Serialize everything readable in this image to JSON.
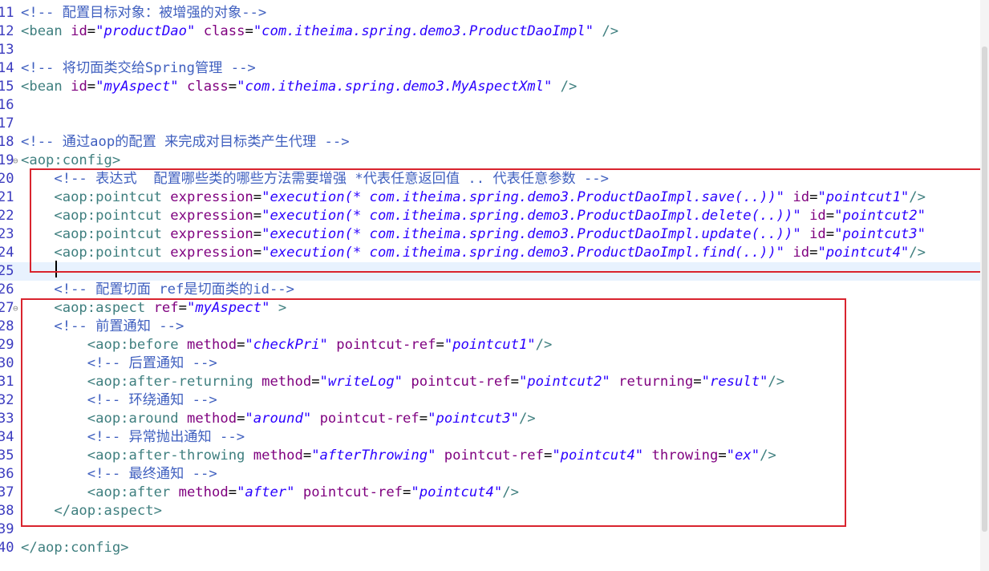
{
  "editor": {
    "lines": [
      {
        "n": "11",
        "segs": [
          {
            "t": "<!-- ",
            "c": "comment"
          },
          {
            "t": "配置目标对象：被增强的对象",
            "c": "comment"
          },
          {
            "t": "-->",
            "c": "comment"
          }
        ]
      },
      {
        "n": "12",
        "segs": [
          {
            "t": "<bean ",
            "c": "tag"
          },
          {
            "t": "id",
            "c": "attr"
          },
          {
            "t": "=",
            "c": "plain"
          },
          {
            "t": "\"productDao\"",
            "c": "val"
          },
          {
            "t": " ",
            "c": "plain"
          },
          {
            "t": "class",
            "c": "attr"
          },
          {
            "t": "=",
            "c": "plain"
          },
          {
            "t": "\"com.itheima.spring.demo3.ProductDaoImpl\"",
            "c": "val"
          },
          {
            "t": " />",
            "c": "tag"
          }
        ]
      },
      {
        "n": "13",
        "segs": []
      },
      {
        "n": "14",
        "segs": [
          {
            "t": "<!-- ",
            "c": "comment"
          },
          {
            "t": "将切面类交给",
            "c": "comment"
          },
          {
            "t": "Spring",
            "c": "comment"
          },
          {
            "t": "管理",
            "c": "comment"
          },
          {
            "t": " -->",
            "c": "comment"
          }
        ]
      },
      {
        "n": "15",
        "segs": [
          {
            "t": "<bean ",
            "c": "tag"
          },
          {
            "t": "id",
            "c": "attr"
          },
          {
            "t": "=",
            "c": "plain"
          },
          {
            "t": "\"myAspect\"",
            "c": "val"
          },
          {
            "t": " ",
            "c": "plain"
          },
          {
            "t": "class",
            "c": "attr"
          },
          {
            "t": "=",
            "c": "plain"
          },
          {
            "t": "\"com.itheima.spring.demo3.MyAspectXml\"",
            "c": "val"
          },
          {
            "t": " />",
            "c": "tag"
          }
        ]
      },
      {
        "n": "16",
        "segs": []
      },
      {
        "n": "17",
        "segs": []
      },
      {
        "n": "18",
        "segs": [
          {
            "t": "<!-- ",
            "c": "comment"
          },
          {
            "t": "通过",
            "c": "comment"
          },
          {
            "t": "aop",
            "c": "comment"
          },
          {
            "t": "的配置 来完成对目标类产生代理",
            "c": "comment"
          },
          {
            "t": " -->",
            "c": "comment"
          }
        ]
      },
      {
        "n": "19",
        "fold": "⊖",
        "segs": [
          {
            "t": "<aop:config>",
            "c": "tag"
          }
        ]
      },
      {
        "n": "20",
        "segs": [
          {
            "t": "    <!-- ",
            "c": "comment"
          },
          {
            "t": "表达式  配置哪些类的哪些方法需要增强",
            "c": "comment"
          },
          {
            "t": " *",
            "c": "comment"
          },
          {
            "t": "代表任意返回值",
            "c": "comment"
          },
          {
            "t": " .. ",
            "c": "comment"
          },
          {
            "t": "代表任意参数",
            "c": "comment"
          },
          {
            "t": " -->",
            "c": "comment"
          }
        ]
      },
      {
        "n": "21",
        "segs": [
          {
            "t": "    <aop:pointcut ",
            "c": "tag"
          },
          {
            "t": "expression",
            "c": "attr"
          },
          {
            "t": "=",
            "c": "plain"
          },
          {
            "t": "\"execution(* com.itheima.spring.demo3.ProductDaoImpl.save(..))\"",
            "c": "val"
          },
          {
            "t": " ",
            "c": "plain"
          },
          {
            "t": "id",
            "c": "attr"
          },
          {
            "t": "=",
            "c": "plain"
          },
          {
            "t": "\"pointcut1\"",
            "c": "val"
          },
          {
            "t": "/>",
            "c": "tag"
          }
        ]
      },
      {
        "n": "22",
        "segs": [
          {
            "t": "    <aop:pointcut ",
            "c": "tag"
          },
          {
            "t": "expression",
            "c": "attr"
          },
          {
            "t": "=",
            "c": "plain"
          },
          {
            "t": "\"execution(* com.itheima.spring.demo3.ProductDaoImpl.delete(..))\"",
            "c": "val"
          },
          {
            "t": " ",
            "c": "plain"
          },
          {
            "t": "id",
            "c": "attr"
          },
          {
            "t": "=",
            "c": "plain"
          },
          {
            "t": "\"pointcut2\"",
            "c": "val"
          }
        ]
      },
      {
        "n": "23",
        "segs": [
          {
            "t": "    <aop:pointcut ",
            "c": "tag"
          },
          {
            "t": "expression",
            "c": "attr"
          },
          {
            "t": "=",
            "c": "plain"
          },
          {
            "t": "\"execution(* com.itheima.spring.demo3.ProductDaoImpl.update(..))\"",
            "c": "val"
          },
          {
            "t": " ",
            "c": "plain"
          },
          {
            "t": "id",
            "c": "attr"
          },
          {
            "t": "=",
            "c": "plain"
          },
          {
            "t": "\"pointcut3\"",
            "c": "val"
          }
        ]
      },
      {
        "n": "24",
        "segs": [
          {
            "t": "    <aop:pointcut ",
            "c": "tag"
          },
          {
            "t": "expression",
            "c": "attr"
          },
          {
            "t": "=",
            "c": "plain"
          },
          {
            "t": "\"execution(* com.itheima.spring.demo3.ProductDaoImpl.find(..))\"",
            "c": "val"
          },
          {
            "t": " ",
            "c": "plain"
          },
          {
            "t": "id",
            "c": "attr"
          },
          {
            "t": "=",
            "c": "plain"
          },
          {
            "t": "\"pointcut4\"",
            "c": "val"
          },
          {
            "t": "/>",
            "c": "tag"
          }
        ]
      },
      {
        "n": "25",
        "current": true,
        "segs": []
      },
      {
        "n": "26",
        "segs": [
          {
            "t": "    <!-- ",
            "c": "comment"
          },
          {
            "t": "配置切面 ",
            "c": "comment"
          },
          {
            "t": "ref",
            "c": "comment"
          },
          {
            "t": "是切面类的",
            "c": "comment"
          },
          {
            "t": "id",
            "c": "comment"
          },
          {
            "t": "-->",
            "c": "comment"
          }
        ]
      },
      {
        "n": "27",
        "fold": "⊖",
        "segs": [
          {
            "t": "    <aop:aspect ",
            "c": "tag"
          },
          {
            "t": "ref",
            "c": "attr"
          },
          {
            "t": "=",
            "c": "plain"
          },
          {
            "t": "\"myAspect\"",
            "c": "val"
          },
          {
            "t": " >",
            "c": "tag"
          }
        ]
      },
      {
        "n": "28",
        "segs": [
          {
            "t": "    <!-- ",
            "c": "comment"
          },
          {
            "t": "前置通知",
            "c": "comment"
          },
          {
            "t": " -->",
            "c": "comment"
          }
        ]
      },
      {
        "n": "29",
        "segs": [
          {
            "t": "        <aop:before ",
            "c": "tag"
          },
          {
            "t": "method",
            "c": "attr"
          },
          {
            "t": "=",
            "c": "plain"
          },
          {
            "t": "\"checkPri\"",
            "c": "val"
          },
          {
            "t": " ",
            "c": "plain"
          },
          {
            "t": "pointcut-ref",
            "c": "attr"
          },
          {
            "t": "=",
            "c": "plain"
          },
          {
            "t": "\"pointcut1\"",
            "c": "val"
          },
          {
            "t": "/>",
            "c": "tag"
          }
        ]
      },
      {
        "n": "30",
        "segs": [
          {
            "t": "        <!-- ",
            "c": "comment"
          },
          {
            "t": "后置通知",
            "c": "comment"
          },
          {
            "t": " -->",
            "c": "comment"
          }
        ]
      },
      {
        "n": "31",
        "segs": [
          {
            "t": "        <aop:after-returning ",
            "c": "tag"
          },
          {
            "t": "method",
            "c": "attr"
          },
          {
            "t": "=",
            "c": "plain"
          },
          {
            "t": "\"writeLog\"",
            "c": "val"
          },
          {
            "t": " ",
            "c": "plain"
          },
          {
            "t": "pointcut-ref",
            "c": "attr"
          },
          {
            "t": "=",
            "c": "plain"
          },
          {
            "t": "\"pointcut2\"",
            "c": "val"
          },
          {
            "t": " ",
            "c": "plain"
          },
          {
            "t": "returning",
            "c": "attr"
          },
          {
            "t": "=",
            "c": "plain"
          },
          {
            "t": "\"result\"",
            "c": "val"
          },
          {
            "t": "/>",
            "c": "tag"
          }
        ]
      },
      {
        "n": "32",
        "segs": [
          {
            "t": "        <!-- ",
            "c": "comment"
          },
          {
            "t": "环绕通知",
            "c": "comment"
          },
          {
            "t": " -->",
            "c": "comment"
          }
        ]
      },
      {
        "n": "33",
        "segs": [
          {
            "t": "        <aop:around ",
            "c": "tag"
          },
          {
            "t": "method",
            "c": "attr"
          },
          {
            "t": "=",
            "c": "plain"
          },
          {
            "t": "\"around\"",
            "c": "val"
          },
          {
            "t": " ",
            "c": "plain"
          },
          {
            "t": "pointcut-ref",
            "c": "attr"
          },
          {
            "t": "=",
            "c": "plain"
          },
          {
            "t": "\"pointcut3\"",
            "c": "val"
          },
          {
            "t": "/>",
            "c": "tag"
          }
        ]
      },
      {
        "n": "34",
        "segs": [
          {
            "t": "        <!-- ",
            "c": "comment"
          },
          {
            "t": "异常抛出通知",
            "c": "comment"
          },
          {
            "t": " -->",
            "c": "comment"
          }
        ]
      },
      {
        "n": "35",
        "segs": [
          {
            "t": "        <aop:after-throwing ",
            "c": "tag"
          },
          {
            "t": "method",
            "c": "attr"
          },
          {
            "t": "=",
            "c": "plain"
          },
          {
            "t": "\"afterThrowing\"",
            "c": "val"
          },
          {
            "t": " ",
            "c": "plain"
          },
          {
            "t": "pointcut-ref",
            "c": "attr"
          },
          {
            "t": "=",
            "c": "plain"
          },
          {
            "t": "\"pointcut4\"",
            "c": "val"
          },
          {
            "t": " ",
            "c": "plain"
          },
          {
            "t": "throwing",
            "c": "attr"
          },
          {
            "t": "=",
            "c": "plain"
          },
          {
            "t": "\"ex\"",
            "c": "val"
          },
          {
            "t": "/>",
            "c": "tag"
          }
        ]
      },
      {
        "n": "36",
        "segs": [
          {
            "t": "        <!-- ",
            "c": "comment"
          },
          {
            "t": "最终通知",
            "c": "comment"
          },
          {
            "t": " -->",
            "c": "comment"
          }
        ]
      },
      {
        "n": "37",
        "segs": [
          {
            "t": "        <aop:after ",
            "c": "tag"
          },
          {
            "t": "method",
            "c": "attr"
          },
          {
            "t": "=",
            "c": "plain"
          },
          {
            "t": "\"after\"",
            "c": "val"
          },
          {
            "t": " ",
            "c": "plain"
          },
          {
            "t": "pointcut-ref",
            "c": "attr"
          },
          {
            "t": "=",
            "c": "plain"
          },
          {
            "t": "\"pointcut4\"",
            "c": "val"
          },
          {
            "t": "/>",
            "c": "tag"
          }
        ]
      },
      {
        "n": "38",
        "segs": [
          {
            "t": "    </aop:aspect>",
            "c": "tag"
          }
        ]
      },
      {
        "n": "39",
        "segs": []
      },
      {
        "n": "40",
        "segs": [
          {
            "t": "</aop:config>",
            "c": "tag"
          }
        ]
      }
    ]
  },
  "colors": {
    "tag": "#3f7f7f",
    "attribute": "#7f007f",
    "value": "#2a00ff",
    "comment": "#3f5fbf",
    "line_number": "#3b3bbf",
    "highlight_box": "#d9242e",
    "current_line": "#e8f2fe"
  }
}
